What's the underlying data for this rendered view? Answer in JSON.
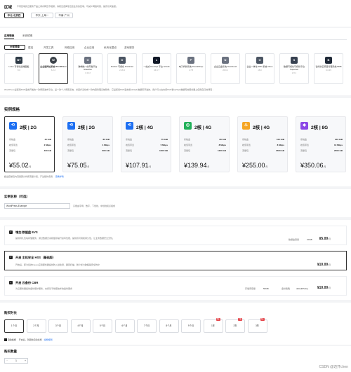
{
  "region": {
    "title": "区域",
    "hint": "不同区域的云服务产品之间内网互不相通；请就近选择靠近您业务的区域，可减少网络时延、提高访问速度。",
    "options": [
      "华北-北京四",
      "华东-上海一",
      "华南-广州"
    ],
    "selected": 0
  },
  "app_image": {
    "title": "应用镜像",
    "tabs": [
      "应用镜像",
      "系统镜像"
    ],
    "filters": [
      "全部镜像",
      "建站",
      "开发工具",
      "网络应用",
      "企业应用",
      "私有化建设",
      "游戏服务"
    ],
    "apps": [
      {
        "icon": "BT",
        "name": "Linux 可视化运维面板",
        "version": "8.0",
        "color": "#2e3a46"
      },
      {
        "icon": "W",
        "name": "企业级网站系统 WordPress",
        "version": "6.2.2",
        "color": "#3c434a",
        "selected": true
      },
      {
        "icon": "G",
        "name": "跨端统一的开发平台 Gitea/Go",
        "version": "4.14.2",
        "color": "#6b7280"
      },
      {
        "icon": "D",
        "name": "Docker 可视化 Portainer",
        "version": "2.18.4",
        "color": "#4b5563"
      },
      {
        "icon": "L",
        "name": "一站式 DevOps 平台 GitLab",
        "version": "16.0.7",
        "color": "#111827"
      },
      {
        "icon": "P",
        "name": "电子商务系统 PrestaShop",
        "version": "1.7.8",
        "color": "#6b7280"
      },
      {
        "icon": "N",
        "name": "企业云盘系统 Nextcloud",
        "version": "26.0.1",
        "color": "#6b7280"
      },
      {
        "icon": "O",
        "name": "企业一体化 ERP 系统 Odoo",
        "version": "16.0",
        "color": "#4b5563"
      },
      {
        "icon": "S",
        "name": "数据可视化可视化平台 Superset",
        "version": "2.0.1",
        "color": "#374151"
      },
      {
        "icon": "B",
        "name": "读好的云项目管理系统 BRB",
        "version": "6.0.45",
        "color": "#1f2937"
      }
    ],
    "description": "WordPress是使用PHP语言开发的一款博客发布平台。是一款个人博客系统，并逐步演化成一款内容管理系统软件，它是使用PHP语言和MySQL数据库开发的，用户可以在支持PHP和MySQL数据库的服务器上使用自己的博客..."
  },
  "specs": {
    "title": "实例规格",
    "row_labels": [
      "系统盘",
      "峰值带宽",
      "流量包"
    ],
    "price_suffix": "/月",
    "items": [
      {
        "name": "2核 | 2G",
        "disk": "40 GiB",
        "bandwidth": "2 Mbps",
        "traffic": "400 GB",
        "price": "¥55.02",
        "color": "#1d6ff2",
        "selected": true
      },
      {
        "name": "2核 | 2G",
        "disk": "80 GiB",
        "bandwidth": "4 Mbps",
        "traffic": "800 GB",
        "price": "¥75.05",
        "color": "#1d6ff2"
      },
      {
        "name": "2核 | 4G",
        "disk": "75 GiB",
        "bandwidth": "5 Mbps",
        "traffic": "1000 GB",
        "price": "¥107.91",
        "color": "#1d6ff2"
      },
      {
        "name": "2核 | 4G",
        "disk": "80 GiB",
        "bandwidth": "8 Mbps",
        "traffic": "1200 GB",
        "price": "¥139.94",
        "color": "#22b05a"
      },
      {
        "name": "2核 | 4G",
        "disk": "100 GiB",
        "bandwidth": "8 Mbps",
        "traffic": "1500 GB",
        "price": "¥255.00",
        "color": "#f5a524"
      },
      {
        "name": "2核 | 8G",
        "disk": "120 GiB",
        "bandwidth": "10 Mbps",
        "traffic": "2000 GB",
        "price": "¥350.06",
        "color": "#8b47e6"
      }
    ],
    "note": "超出套餐包内流量部分将按流量计费，产生额外费用",
    "note_link": "查看详情"
  },
  "instance_name": {
    "title": "实例名称（可选）",
    "value": "WordPress-Example",
    "hint": "只能由字母、数字、下划线、中划线和点组成"
  },
  "addons": [
    {
      "title": "增加 数据盘 EVS",
      "desc": "提供持久性块存储服务，通过数据冗余和缓存提升读写性能，提供高可用和持久性，让业务数据安全无忧。",
      "field_label": "数据盘容量",
      "field_value": "10GB",
      "price": "¥5.00",
      "suffix": "/月"
    },
    {
      "title": "开启 主机安全 HSS（基础版）",
      "desc": "开启后，即为您的Flexus应用服务器提供防入侵检测、漏洞扫描、账户暴力破解等安全防护",
      "field_label": "",
      "field_value": "",
      "price": "¥10.00",
      "suffix": "/月"
    },
    {
      "title": "开启 云备份 CBR",
      "desc": "为云服务器提供备份保护服务，支持基于快照技术的备份服务",
      "field_label": "存储库容量",
      "field_value": "50GB",
      "field_label2": "备份策略",
      "field_value2": "defaultPolicy",
      "price": "¥10.00",
      "suffix": "/月"
    }
  ],
  "duration": {
    "title": "购买时长",
    "options": [
      "1个月",
      "2个月",
      "3个月",
      "4个月",
      "5个月",
      "6个月",
      "7个月",
      "8个月",
      "9个月",
      "1年",
      "2年",
      "3年"
    ],
    "tags": [
      "",
      "",
      "",
      "",
      "",
      "",
      "",
      "",
      "",
      "8折",
      "7折",
      "5折"
    ],
    "selected": 0,
    "auto_renew_label": "自动续费",
    "auto_renew_desc": "开启后，到期前自动续费",
    "auto_renew_link": "续费规则"
  },
  "quantity": {
    "title": "购买数量",
    "value": "1",
    "minus": "−",
    "plus": "+"
  },
  "watermark": "CSDN @迈开chen"
}
